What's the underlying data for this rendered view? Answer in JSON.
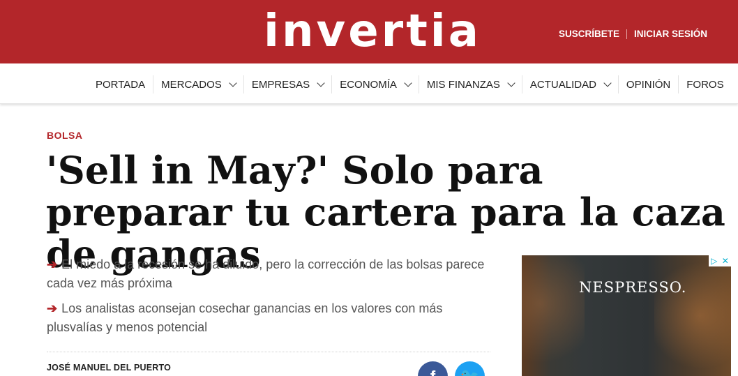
{
  "header": {
    "logo_text": "invertia",
    "subscribe_label": "SUSCRÍBETE",
    "login_label": "INICIAR SESIÓN",
    "brand_color": "#b3262a"
  },
  "nav": {
    "items": [
      {
        "label": "PORTADA",
        "has_dropdown": false
      },
      {
        "label": "MERCADOS",
        "has_dropdown": true
      },
      {
        "label": "EMPRESAS",
        "has_dropdown": true
      },
      {
        "label": "ECONOMÍA",
        "has_dropdown": true
      },
      {
        "label": "MIS FINANZAS",
        "has_dropdown": true
      },
      {
        "label": "ACTUALIDAD",
        "has_dropdown": true
      },
      {
        "label": "OPINIÓN",
        "has_dropdown": false
      },
      {
        "label": "FOROS",
        "has_dropdown": false
      }
    ]
  },
  "article": {
    "kicker": "BOLSA",
    "headline": "'Sell in May?' Solo para preparar tu cartera para la caza de gangas",
    "bullets": [
      "El miedo a la recesión se ha diluido, pero la corrección de las bolsas parece cada vez más próxima",
      "Los analistas aconsejan cosechar ganancias en los valores con más plusvalías y menos potencial"
    ],
    "author": "JOSÉ MANUEL DEL PUERTO",
    "share": {
      "facebook_glyph": "f",
      "twitter_glyph": "✓",
      "facebook_icon": "facebook-icon",
      "twitter_icon": "twitter-icon"
    }
  },
  "ad": {
    "brand_text": "NESPRESSO.",
    "choices_icon": "adchoices-icon",
    "close_glyph": "✕",
    "info_glyph": "▷"
  }
}
